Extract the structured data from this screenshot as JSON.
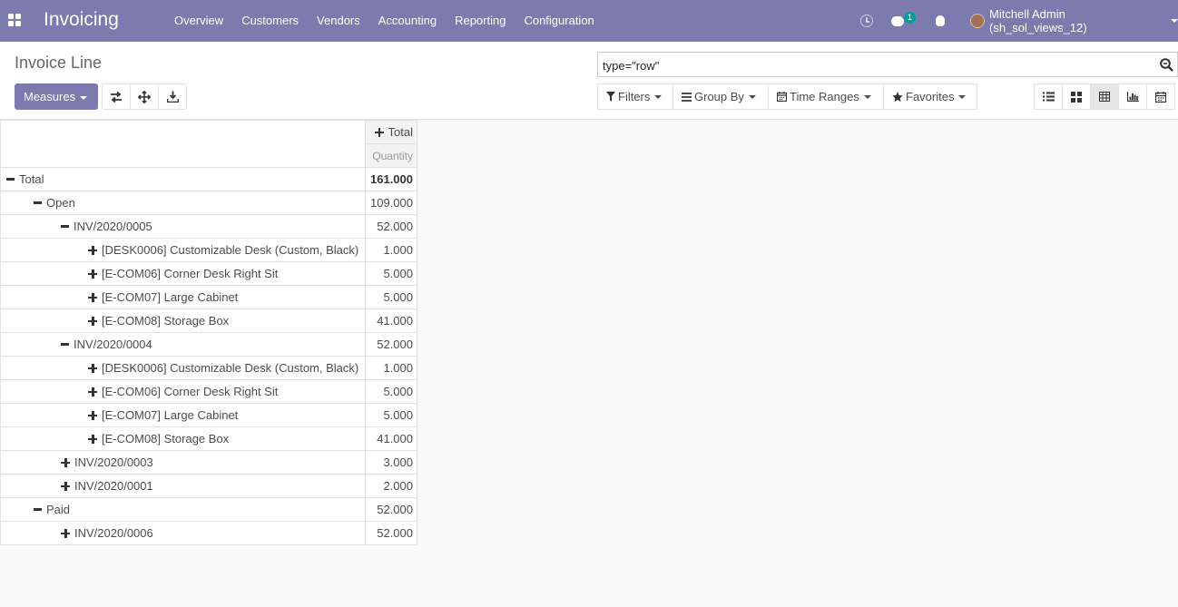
{
  "navbar": {
    "brand": "Invoicing",
    "menu": [
      "Overview",
      "Customers",
      "Vendors",
      "Accounting",
      "Reporting",
      "Configuration"
    ],
    "chat_badge": "1",
    "user": "Mitchell Admin (sh_sol_views_12)"
  },
  "control": {
    "title": "Invoice Line",
    "measures_label": "Measures",
    "search_value": "type=\"row\"",
    "filters_label": "Filters",
    "group_by_label": "Group By",
    "time_ranges_label": "Time Ranges",
    "favorites_label": "Favorites"
  },
  "pivot": {
    "col_header": "Total",
    "measure": "Quantity",
    "rows": [
      {
        "label": "Total",
        "value": "161.000",
        "level": 0,
        "expanded": true,
        "bold": true
      },
      {
        "label": "Open",
        "value": "109.000",
        "level": 1,
        "expanded": true
      },
      {
        "label": "INV/2020/0005",
        "value": "52.000",
        "level": 2,
        "expanded": true
      },
      {
        "label": "[DESK0006] Customizable Desk (Custom, Black)",
        "value": "1.000",
        "level": 3,
        "expanded": false
      },
      {
        "label": "[E-COM06] Corner Desk Right Sit",
        "value": "5.000",
        "level": 3,
        "expanded": false
      },
      {
        "label": "[E-COM07] Large Cabinet",
        "value": "5.000",
        "level": 3,
        "expanded": false
      },
      {
        "label": "[E-COM08] Storage Box",
        "value": "41.000",
        "level": 3,
        "expanded": false
      },
      {
        "label": "INV/2020/0004",
        "value": "52.000",
        "level": 2,
        "expanded": true
      },
      {
        "label": "[DESK0006] Customizable Desk (Custom, Black)",
        "value": "1.000",
        "level": 3,
        "expanded": false
      },
      {
        "label": "[E-COM06] Corner Desk Right Sit",
        "value": "5.000",
        "level": 3,
        "expanded": false
      },
      {
        "label": "[E-COM07] Large Cabinet",
        "value": "5.000",
        "level": 3,
        "expanded": false
      },
      {
        "label": "[E-COM08] Storage Box",
        "value": "41.000",
        "level": 3,
        "expanded": false
      },
      {
        "label": "INV/2020/0003",
        "value": "3.000",
        "level": 2,
        "expanded": false
      },
      {
        "label": "INV/2020/0001",
        "value": "2.000",
        "level": 2,
        "expanded": false
      },
      {
        "label": "Paid",
        "value": "52.000",
        "level": 1,
        "expanded": true
      },
      {
        "label": "INV/2020/0006",
        "value": "52.000",
        "level": 2,
        "expanded": false
      }
    ]
  },
  "colors": {
    "navbar": "#7c7bad",
    "badge": "#00a09d"
  }
}
